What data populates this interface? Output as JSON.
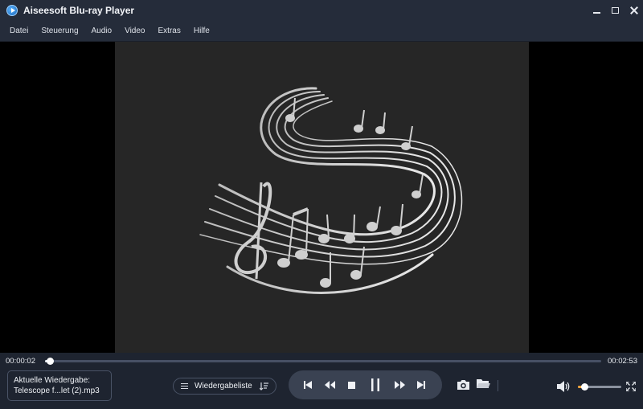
{
  "window": {
    "title": "Aiseesoft Blu-ray Player"
  },
  "menu": {
    "items": [
      "Datei",
      "Steuerung",
      "Audio",
      "Video",
      "Extras",
      "Hilfe"
    ]
  },
  "playback": {
    "current_time": "00:00:02",
    "total_time": "00:02:53",
    "progress_fraction": 0.009,
    "now_playing_label": "Aktuelle Wiedergabe:",
    "now_playing_file": "Telescope f...let (2).mp3",
    "playlist_label": "Wiedergabeliste",
    "volume_fraction": 0.15
  },
  "icons": {
    "transport": [
      "skip-previous-icon",
      "rewind-icon",
      "stop-icon",
      "pause-icon",
      "fast-forward-icon",
      "skip-next-icon"
    ]
  },
  "colors": {
    "accent": "#f0a23a",
    "background": "#1e2430",
    "titlebar": "#252c3a"
  }
}
